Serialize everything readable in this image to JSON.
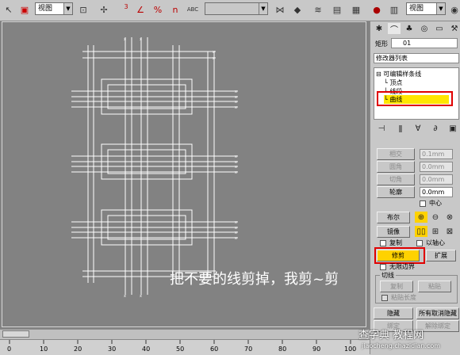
{
  "toolbar": {
    "view_dropdown_1": "视图",
    "view_dropdown_2": "视图",
    "selection_set": "",
    "percent_label": "%",
    "abc_label": "ABC",
    "magnet_label": "n",
    "number_label": "3"
  },
  "viewport": {
    "caption": "把不要的线剪掉，我剪~剪"
  },
  "ruler": {
    "labels": [
      "0",
      "10",
      "20",
      "30",
      "40",
      "50",
      "60",
      "70",
      "80",
      "90",
      "100"
    ]
  },
  "panel": {
    "object_name_label": "矩形",
    "object_name_value": "01",
    "modifier_list": "修改器列表",
    "stack_root": "可编辑样条线",
    "stack_vertex": "顶点",
    "stack_segment": "线段",
    "stack_spline": "曲线",
    "btn_intersect": "相交",
    "btn_fillet": "圆角",
    "btn_chamfer": "切角",
    "btn_outline": "轮廓",
    "spin_intersect": "0.1mm",
    "spin_fillet": "0.0mm",
    "spin_chamfer": "0.0mm",
    "spin_outline": "0.0mm",
    "chk_center": "中心",
    "btn_boolean": "布尔",
    "btn_mirror": "镜像",
    "chk_copy": "复制",
    "chk_about_pivot": "以轴心",
    "btn_trim": "修剪",
    "btn_extend": "扩展",
    "chk_infinite": "无限边界",
    "group_tangent": "切线",
    "btn_copy_tangent": "复制",
    "btn_paste_tangent": "粘贴",
    "chk_paste_length": "粘贴长度",
    "btn_hide": "隐藏",
    "btn_unhide_all": "所有取消隐藏",
    "btn_bind": "绑定",
    "btn_unbind": "解除绑定"
  },
  "watermark": {
    "text": "查字典 教程网",
    "url": "jiaocheng.chazidian.com"
  }
}
